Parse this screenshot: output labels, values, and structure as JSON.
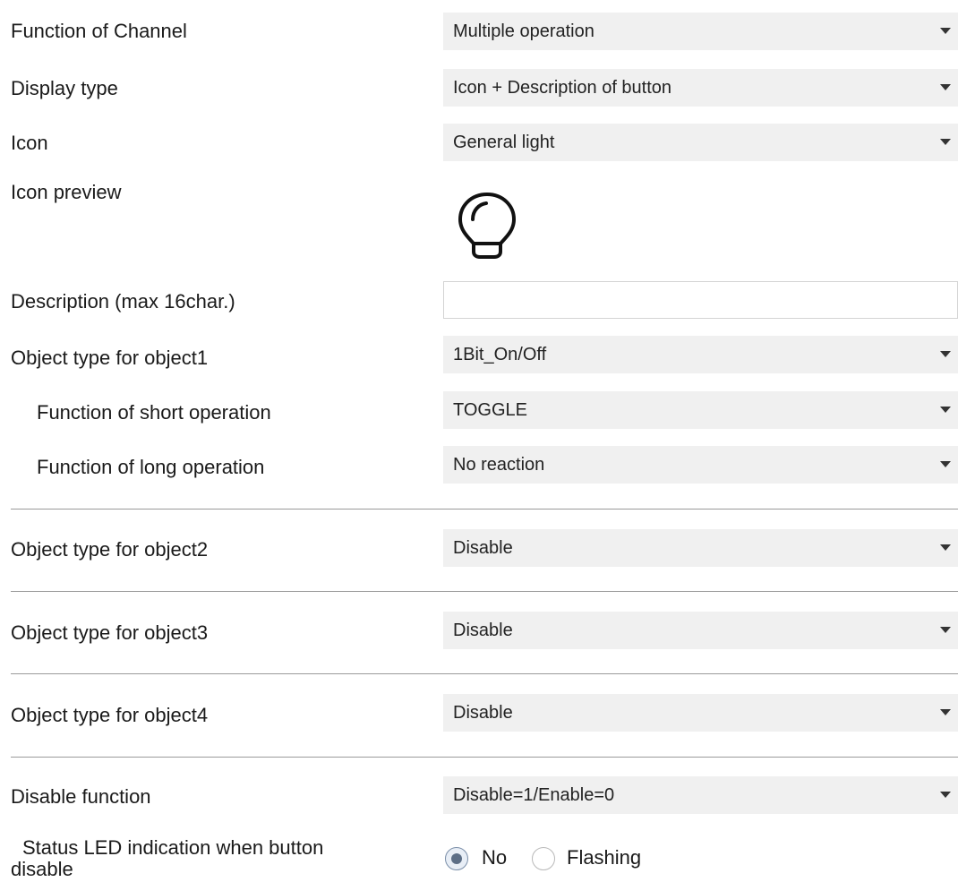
{
  "rows": {
    "function_of_channel": {
      "label": "Function of Channel",
      "value": "Multiple operation"
    },
    "display_type": {
      "label": "Display type",
      "value": "Icon + Description of button"
    },
    "icon": {
      "label": "Icon",
      "value": "General light"
    },
    "icon_preview": {
      "label": "Icon preview",
      "icon_name": "light-bulb-icon"
    },
    "description": {
      "label": "Description (max 16char.)",
      "value": ""
    },
    "object1_type": {
      "label": "Object type for object1",
      "value": "1Bit_On/Off"
    },
    "short_operation": {
      "label": "Function of short operation",
      "value": "TOGGLE"
    },
    "long_operation": {
      "label": "Function of long operation",
      "value": "No reaction"
    },
    "object2_type": {
      "label": "Object type for object2",
      "value": "Disable"
    },
    "object3_type": {
      "label": "Object type for object3",
      "value": "Disable"
    },
    "object4_type": {
      "label": "Object type for object4",
      "value": "Disable"
    },
    "disable_function": {
      "label": "Disable function",
      "value": "Disable=1/Enable=0"
    },
    "status_led": {
      "label_line1": "Status LED indication when button",
      "label_line2": "disable",
      "options": [
        "No",
        "Flashing"
      ],
      "selected": "No"
    }
  },
  "icons": {
    "dropdown_arrow": "chevron-down-icon",
    "preview": "light-bulb-icon"
  }
}
